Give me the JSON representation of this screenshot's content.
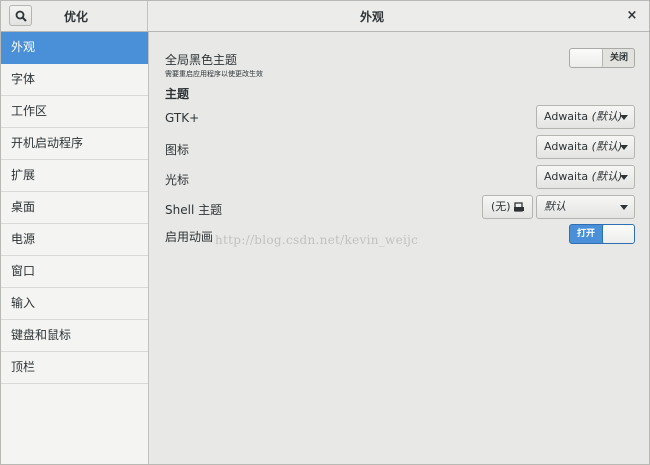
{
  "header": {
    "app_title": "优化",
    "page_title": "外观",
    "close_glyph": "×",
    "search_icon": "search-icon"
  },
  "sidebar": {
    "items": [
      {
        "label": "外观",
        "active": true
      },
      {
        "label": "字体",
        "active": false
      },
      {
        "label": "工作区",
        "active": false
      },
      {
        "label": "开机启动程序",
        "active": false
      },
      {
        "label": "扩展",
        "active": false
      },
      {
        "label": "桌面",
        "active": false
      },
      {
        "label": "电源",
        "active": false
      },
      {
        "label": "窗口",
        "active": false
      },
      {
        "label": "输入",
        "active": false
      },
      {
        "label": "键盘和鼠标",
        "active": false
      },
      {
        "label": "顶栏",
        "active": false
      }
    ]
  },
  "appearance": {
    "dark_theme": {
      "label": "全局黑色主题",
      "note": "需要重启应用程序以使更改生效",
      "switch_text": "关闭",
      "state": "off"
    },
    "themes_heading": "主题",
    "gtk": {
      "label": "GTK+",
      "value_name": "Adwaita",
      "value_suffix": "(默认)"
    },
    "icons": {
      "label": "图标",
      "value_name": "Adwaita",
      "value_suffix": "(默认)"
    },
    "cursor": {
      "label": "光标",
      "value_name": "Adwaita",
      "value_suffix": "(默认)"
    },
    "shell": {
      "label": "Shell 主题",
      "file_button": "(无)",
      "file_icon": "eject-icon",
      "value": "默认"
    },
    "animations": {
      "label": "启用动画",
      "switch_text": "打开",
      "state": "on"
    }
  },
  "watermark": "http://blog.csdn.net/kevin_weijc",
  "colors": {
    "accent": "#4a90d9",
    "background": "#e8e8e7",
    "sidebar": "#f4f4f3"
  }
}
